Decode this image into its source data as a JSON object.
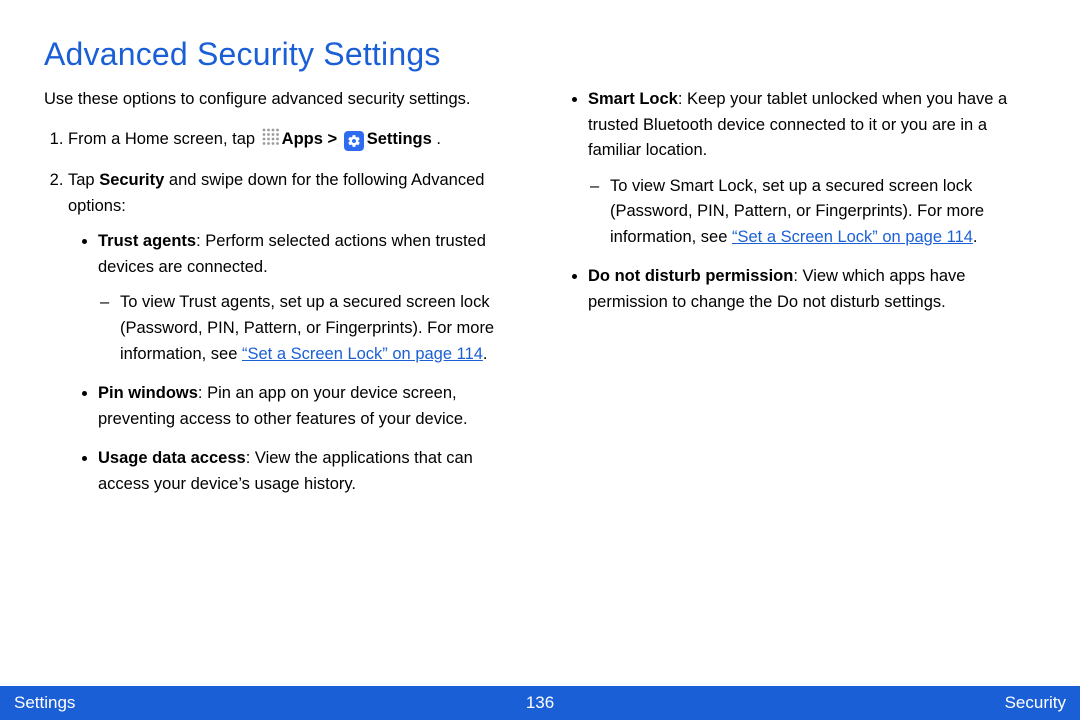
{
  "title": "Advanced Security Settings",
  "intro": "Use these options to configure advanced security settings.",
  "step1_prefix": "From a Home screen, tap ",
  "apps_label": "Apps",
  "gt": " > ",
  "settings_label": "Settings",
  "step1_suffix": " .",
  "step2_prefix": "Tap ",
  "security_label": "Security",
  "step2_suffix": " and swipe down for the following Advanced options:",
  "trust_agents_label": "Trust agents",
  "trust_agents_desc": ": Perform selected actions when trusted devices are connected.",
  "trust_agents_sub": "To view Trust agents, set up a secured screen lock (Password, PIN, Pattern, or Fingerprints). For more information, see ",
  "screen_lock_link": "“Set a Screen Lock” on page 114",
  "dot": ".",
  "pin_windows_label": "Pin windows",
  "pin_windows_desc": ": Pin an app on your device screen, preventing access to other features of your device.",
  "usage_data_label": "Usage data access",
  "usage_data_desc": ": View the applications that can access your device’s usage history.",
  "smart_lock_label": "Smart Lock",
  "smart_lock_desc": ": Keep your tablet unlocked when you have a trusted Bluetooth device connected to it or you are in a familiar location.",
  "smart_lock_sub": "To view Smart Lock, set up a secured screen lock (Password, PIN, Pattern, or Fingerprints). For more information, see ",
  "dnd_label": "Do not disturb permission",
  "dnd_desc": ": View which apps have permission to change the Do not disturb settings.",
  "footer_left": "Settings",
  "footer_center": "136",
  "footer_right": "Security"
}
